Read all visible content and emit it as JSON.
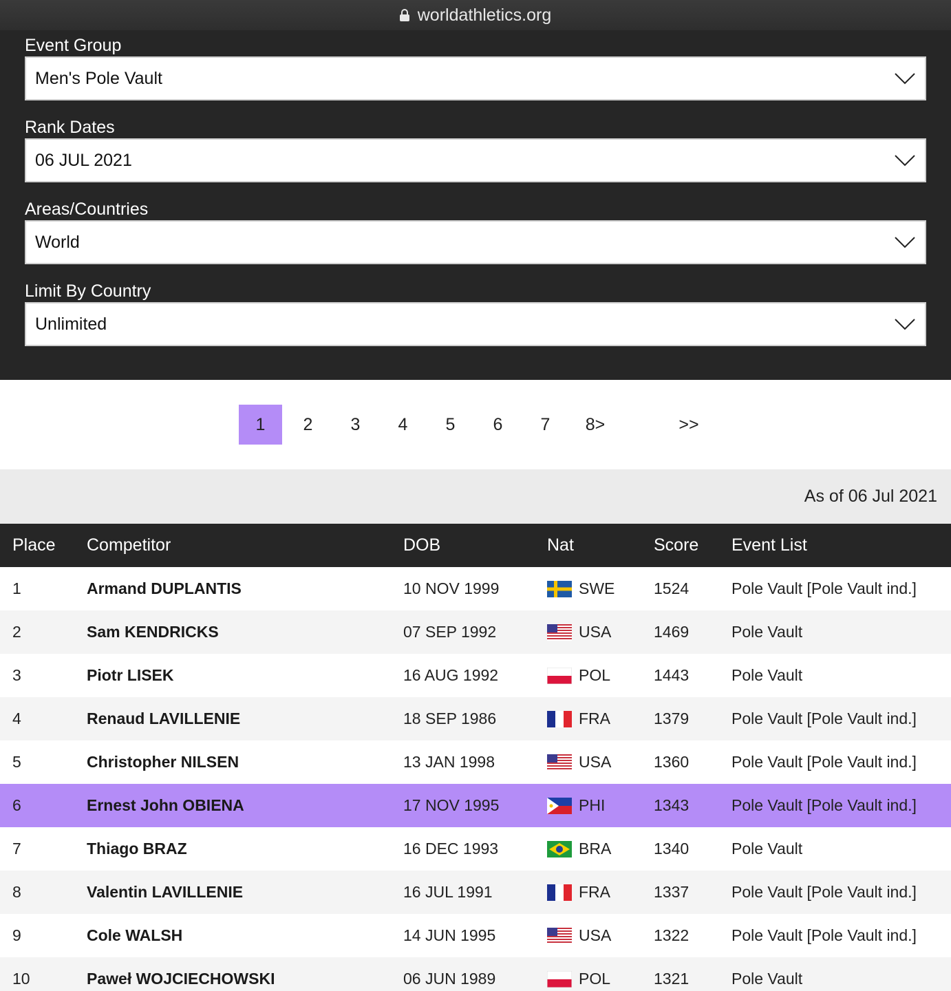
{
  "browser": {
    "url": "worldathletics.org"
  },
  "filters": [
    {
      "label": "Event Group",
      "value": "Men's Pole Vault"
    },
    {
      "label": "Rank Dates",
      "value": "06 JUL 2021"
    },
    {
      "label": "Areas/Countries",
      "value": "World"
    },
    {
      "label": "Limit By Country",
      "value": "Unlimited"
    }
  ],
  "pagination": {
    "pages": [
      "1",
      "2",
      "3",
      "4",
      "5",
      "6",
      "7",
      "8>"
    ],
    "active": "1",
    "last": ">>"
  },
  "as_of": "As of 06 Jul 2021",
  "table": {
    "columns": [
      "Place",
      "Competitor",
      "DOB",
      "Nat",
      "Score",
      "Event List"
    ],
    "rows": [
      {
        "place": "1",
        "competitor": "Armand DUPLANTIS",
        "dob": "10 NOV 1999",
        "nat": "SWE",
        "flag": "sweden-flag-icon",
        "score": "1524",
        "events": "Pole Vault [Pole Vault ind.]"
      },
      {
        "place": "2",
        "competitor": "Sam KENDRICKS",
        "dob": "07 SEP 1992",
        "nat": "USA",
        "flag": "usa-flag-icon",
        "score": "1469",
        "events": "Pole Vault"
      },
      {
        "place": "3",
        "competitor": "Piotr LISEK",
        "dob": "16 AUG 1992",
        "nat": "POL",
        "flag": "poland-flag-icon",
        "score": "1443",
        "events": "Pole Vault"
      },
      {
        "place": "4",
        "competitor": "Renaud LAVILLENIE",
        "dob": "18 SEP 1986",
        "nat": "FRA",
        "flag": "france-flag-icon",
        "score": "1379",
        "events": "Pole Vault [Pole Vault ind.]"
      },
      {
        "place": "5",
        "competitor": "Christopher NILSEN",
        "dob": "13 JAN 1998",
        "nat": "USA",
        "flag": "usa-flag-icon",
        "score": "1360",
        "events": "Pole Vault [Pole Vault ind.]"
      },
      {
        "place": "6",
        "competitor": "Ernest John OBIENA",
        "dob": "17 NOV 1995",
        "nat": "PHI",
        "flag": "philippines-flag-icon",
        "score": "1343",
        "events": "Pole Vault [Pole Vault ind.]",
        "highlighted": true
      },
      {
        "place": "7",
        "competitor": "Thiago BRAZ",
        "dob": "16 DEC 1993",
        "nat": "BRA",
        "flag": "brazil-flag-icon",
        "score": "1340",
        "events": "Pole Vault"
      },
      {
        "place": "8",
        "competitor": "Valentin LAVILLENIE",
        "dob": "16 JUL 1991",
        "nat": "FRA",
        "flag": "france-flag-icon",
        "score": "1337",
        "events": "Pole Vault [Pole Vault ind.]"
      },
      {
        "place": "9",
        "competitor": "Cole WALSH",
        "dob": "14 JUN 1995",
        "nat": "USA",
        "flag": "usa-flag-icon",
        "score": "1322",
        "events": "Pole Vault [Pole Vault ind.]"
      },
      {
        "place": "10",
        "competitor": "Paweł WOJCIECHOWSKI",
        "dob": "06 JUN 1989",
        "nat": "POL",
        "flag": "poland-flag-icon",
        "score": "1321",
        "events": "Pole Vault"
      }
    ]
  },
  "colors": {
    "accent": "#b48cf7",
    "dark": "#262626"
  }
}
